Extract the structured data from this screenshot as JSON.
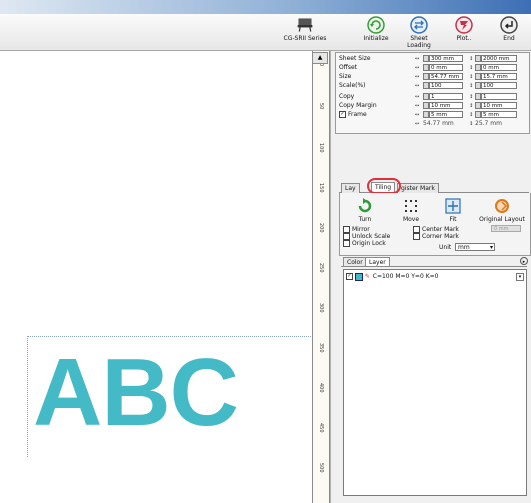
{
  "toolbar": {
    "device_label": "CG-SRII Series",
    "initialize_label": "Initialize",
    "sheet_loading_label": "Sheet Loading",
    "plot_label": "Plot..",
    "end_label": "End"
  },
  "canvas": {
    "text": "ABC",
    "text_color": "#43bac6"
  },
  "ruler": {
    "labels": [
      "0",
      "50",
      "100",
      "150",
      "200",
      "250",
      "300",
      "350",
      "400",
      "450",
      "500"
    ]
  },
  "settings": {
    "rows": [
      {
        "label": "Sheet Size",
        "x": "300 mm",
        "y": "2000 mm"
      },
      {
        "label": "Offset",
        "x": "0 mm",
        "y": "0 mm"
      },
      {
        "label": "Size",
        "x": "54.77 mm",
        "y": "15.7 mm"
      },
      {
        "label": "Scale(%)",
        "x": "100",
        "y": "100"
      },
      {
        "label": "Copy",
        "x": "1",
        "y": "1"
      },
      {
        "label": "Copy Margin",
        "x": "10 mm",
        "y": "10 mm"
      },
      {
        "label": "Frame",
        "x": "5 mm",
        "y": "5 mm"
      }
    ],
    "frame_checked": "✓",
    "bottom_x": "54.77 mm",
    "bottom_y": "25.7 mm"
  },
  "layout_tabs": {
    "tab1": "Lay",
    "tab2": "Tiling",
    "tab3": "gister Mark"
  },
  "tools": {
    "turn": "Turn",
    "move": "Move",
    "fit": "Fit",
    "original_layout": "Original Layout",
    "gray_field": "0 mm"
  },
  "options": {
    "mirror": "Mirror",
    "unlock_scale": "Unlock Scale",
    "origin_lock": "Origin Lock",
    "center_mark": "Center Mark",
    "corner_mark": "Corner Mark",
    "unit_label": "Unit",
    "unit_value": "mm"
  },
  "color_tabs": {
    "tab1": "Color",
    "tab2": "Layer"
  },
  "color_list": {
    "entry": "C=100 M=0 Y=0 K=0",
    "swatch_color": "#43bac6"
  },
  "colors": {
    "highlight_ring": "#e0303a",
    "initialize_icon": "#3a9a3a",
    "sheet_loading_icon": "#2f6fb7",
    "plot_icon": "#c0334a"
  }
}
